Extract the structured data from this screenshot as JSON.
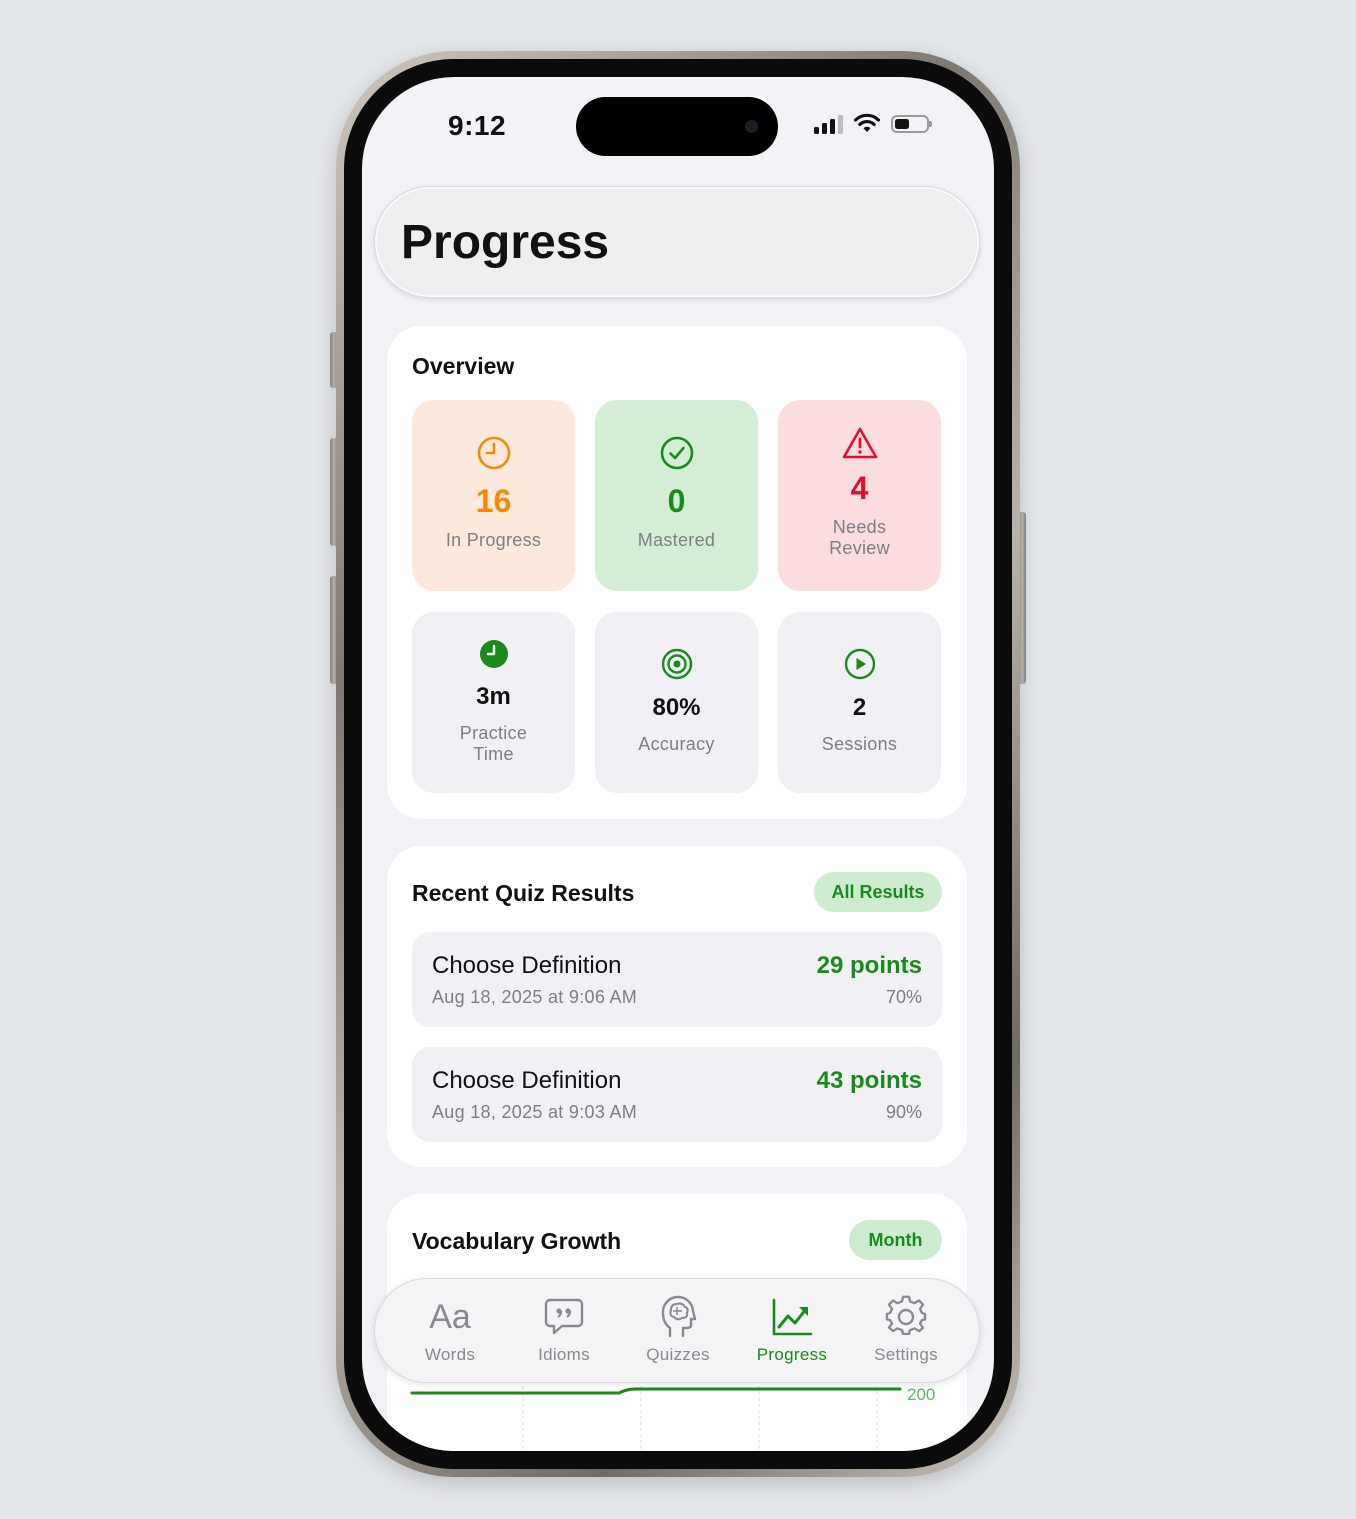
{
  "status": {
    "time": "9:12"
  },
  "header": {
    "title": "Progress"
  },
  "overview": {
    "title": "Overview",
    "tiles": [
      {
        "value": "16",
        "label": "In Progress",
        "icon": "clock-icon",
        "color": "#f58a07",
        "bg": "#fde9dc"
      },
      {
        "value": "0",
        "label": "Mastered",
        "icon": "checkmark-circle-icon",
        "color": "#1a8a1a",
        "bg": "#d4eed6"
      },
      {
        "value": "4",
        "label": "Needs Review",
        "icon": "warning-triangle-icon",
        "color": "#e0102f",
        "bg": "#fbdde0"
      },
      {
        "value": "3m",
        "label": "Practice Time",
        "icon": "clock-filled-icon",
        "color": "#1a8a1a",
        "bg": "#f1f1f5"
      },
      {
        "value": "80%",
        "label": "Accuracy",
        "icon": "target-icon",
        "color": "#1a8a1a",
        "bg": "#f1f1f5"
      },
      {
        "value": "2",
        "label": "Sessions",
        "icon": "play-circle-icon",
        "color": "#1a8a1a",
        "bg": "#f1f1f5"
      }
    ]
  },
  "quiz_results": {
    "title": "Recent Quiz Results",
    "all_results_label": "All Results",
    "items": [
      {
        "name": "Choose Definition",
        "date": "Aug 18, 2025 at 9:06 AM",
        "points": "29 points",
        "percent": "70%"
      },
      {
        "name": "Choose Definition",
        "date": "Aug 18, 2025 at 9:03 AM",
        "points": "43 points",
        "percent": "90%"
      }
    ]
  },
  "vocab_growth": {
    "title": "Vocabulary Growth",
    "period_label": "Month",
    "y_tick": "200"
  },
  "tabs": [
    {
      "label": "Words",
      "icon": "text-aa-icon",
      "active": false
    },
    {
      "label": "Idioms",
      "icon": "quote-bubble-icon",
      "active": false
    },
    {
      "label": "Quizzes",
      "icon": "brain-head-icon",
      "active": false
    },
    {
      "label": "Progress",
      "icon": "chart-line-up-icon",
      "active": true
    },
    {
      "label": "Settings",
      "icon": "gear-icon",
      "active": false
    }
  ],
  "colors": {
    "accent": "#1a8a1a",
    "warning": "#f58a07",
    "danger": "#e0102f"
  }
}
